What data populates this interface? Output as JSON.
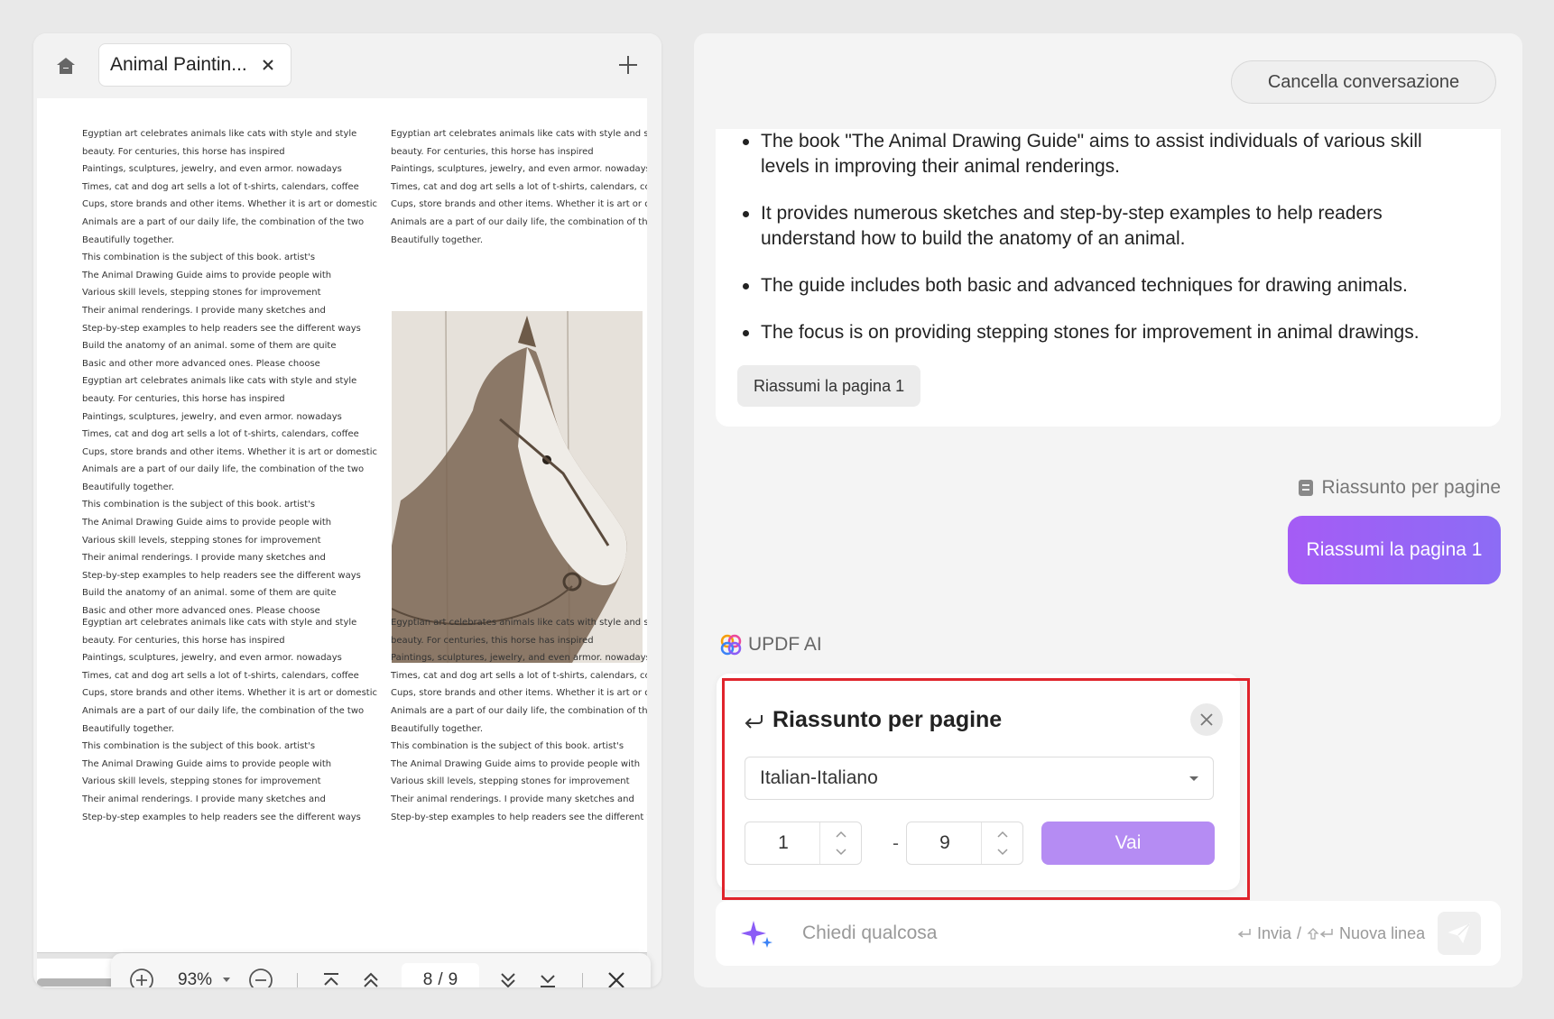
{
  "viewer": {
    "tab_title": "Animal Paintin...",
    "zoom": "93%",
    "current_page": "8",
    "page_separator": "/",
    "total_pages": "9",
    "page1_left_col": [
      "Egyptian art celebrates animals like cats with style and style",
      "beauty. For centuries, this horse has inspired",
      "Paintings, sculptures, jewelry, and even armor. nowadays",
      "Times, cat and dog art sells a lot of t-shirts, calendars, coffee",
      "Cups, store brands and other items. Whether it is art or domestic",
      "Animals are a part of our daily life, the combination of the two",
      "Beautifully together.",
      "This combination is the subject of this book. artist's",
      "The Animal Drawing Guide aims to provide people with",
      "Various skill levels, stepping stones for improvement",
      "Their animal renderings. I provide many sketches and",
      "Step-by-step examples to help readers see the different ways",
      "Build the anatomy of an animal. some of them are quite",
      "Basic and other more advanced ones. Please choose",
      "Egyptian art celebrates animals like cats with style and style",
      "beauty. For centuries, this horse has inspired",
      "Paintings, sculptures, jewelry, and even armor. nowadays",
      "Times, cat and dog art sells a lot of t-shirts, calendars, coffee",
      "Cups, store brands and other items. Whether it is art or domestic",
      "Animals are a part of our daily life, the combination of the two",
      "Beautifully together.",
      "This combination is the subject of this book. artist's",
      "The Animal Drawing Guide aims to provide people with",
      "Various skill levels, stepping stones for improvement",
      "Their animal renderings. I provide many sketches and",
      "Step-by-step examples to help readers see the different ways",
      "Build the anatomy of an animal. some of them are quite",
      "Basic and other more advanced ones. Please choose"
    ],
    "page1_right_col": [
      "Egyptian art celebrates animals like cats with style and style",
      "beauty. For centuries, this horse has inspired",
      "Paintings, sculptures, jewelry, and even armor. nowadays",
      "Times, cat and dog art sells a lot of t-shirts, calendars, coffee",
      "Cups, store brands and other items. Whether it is art or domestic",
      "Animals are a part of our daily life, the combination of the two",
      "Beautifully together."
    ],
    "page1_bottom_left": [
      "Egyptian art celebrates animals like cats with style and style",
      "beauty. For centuries, this horse has inspired",
      "Paintings, sculptures, jewelry, and even armor. nowadays",
      "Times, cat and dog art sells a lot of t-shirts, calendars, coffee",
      "Cups, store brands and other items. Whether it is art or domestic",
      "Animals are a part of our daily life, the combination of the two",
      "Beautifully together.",
      "This combination is the subject of this book. artist's",
      "The Animal Drawing Guide aims to provide people with",
      "Various skill levels, stepping stones for improvement",
      "Their animal renderings. I provide many sketches and",
      "Step-by-step examples to help readers see the different ways"
    ],
    "page1_bottom_right": [
      "Egyptian art celebrates animals like cats with style and style",
      "beauty. For centuries, this horse has inspired",
      "Paintings, sculptures, jewelry, and even armor. nowadays",
      "Times, cat and dog art sells a lot of t-shirts, calendars, coffee",
      "Cups, store brands and other items. Whether it is art or domestic",
      "Animals are a part of our daily life, the combination of the two",
      "Beautifully together.",
      "This combination is the subject of this book. artist's",
      "The Animal Drawing Guide aims to provide people with",
      "Various skill levels, stepping stones for improvement",
      "Their animal renderings. I provide many sketches and",
      "Step-by-step examples to help readers see the different ways"
    ]
  },
  "chat": {
    "clear_label": "Cancella conversazione",
    "answer_bullets": [
      "The book \"The Animal Drawing Guide\" aims to assist individuals of various skill levels in improving their animal renderings.",
      "It provides numerous sketches and step-by-step examples to help readers understand how to build the anatomy of an animal.",
      "The guide includes both basic and advanced techniques for drawing animals.",
      "The focus is on providing stepping stones for improvement in animal drawings."
    ],
    "answer_chip": "Riassumi la pagina 1",
    "user_label": "Riassunto per pagine",
    "user_message": "Riassumi la pagina 1",
    "ai_name": "UPDF AI",
    "form": {
      "title": "Riassunto per pagine",
      "language": "Italian-Italiano",
      "from_page": "1",
      "dash": "-",
      "to_page": "9",
      "go_label": "Vai"
    },
    "input_placeholder": "Chiedi qualcosa",
    "send_hint": "Invia",
    "hint_sep": "/",
    "newline_hint": "Nuova linea"
  },
  "colors": {
    "accent_purple": "#a55cf5",
    "go_button": "#b58cf3",
    "highlight": "#e0242c"
  },
  "icons": [
    "home-icon",
    "close-icon",
    "plus-icon",
    "zoom-in-icon",
    "zoom-out-icon",
    "first-page-icon",
    "prev-page-icon",
    "next-page-icon",
    "last-page-icon",
    "sparkle-icon",
    "send-icon",
    "return-icon",
    "document-icon"
  ]
}
